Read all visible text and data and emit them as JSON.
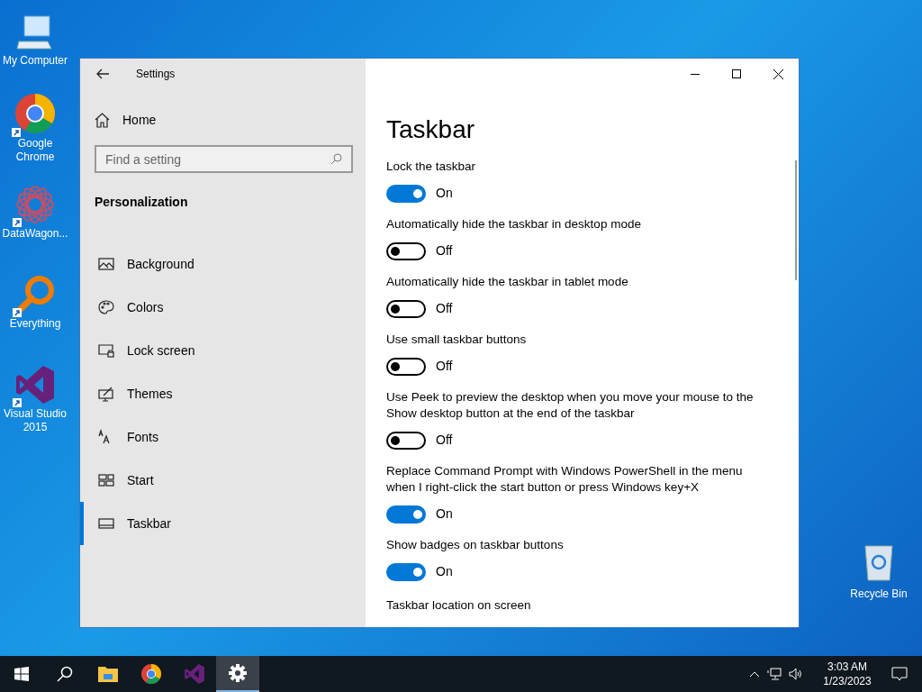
{
  "desktop_icons": [
    {
      "label": "My Computer",
      "kind": "computer",
      "shortcut": false
    },
    {
      "label": "Google Chrome",
      "kind": "chrome",
      "shortcut": true
    },
    {
      "label": "DataWagon...",
      "kind": "flower",
      "shortcut": true
    },
    {
      "label": "Everything",
      "kind": "magnifier",
      "shortcut": true
    },
    {
      "label": "Visual Studio 2015",
      "kind": "vs",
      "shortcut": true
    }
  ],
  "recycle_bin": {
    "label": "Recycle Bin"
  },
  "window": {
    "title": "Settings",
    "home": "Home",
    "search": {
      "placeholder": "Find a setting"
    },
    "section": "Personalization",
    "nav": [
      {
        "label": "Background",
        "kind": "image",
        "selected": false
      },
      {
        "label": "Colors",
        "kind": "palette",
        "selected": false
      },
      {
        "label": "Lock screen",
        "kind": "lock",
        "selected": false
      },
      {
        "label": "Themes",
        "kind": "themes",
        "selected": false
      },
      {
        "label": "Fonts",
        "kind": "fonts",
        "selected": false
      },
      {
        "label": "Start",
        "kind": "start",
        "selected": false
      },
      {
        "label": "Taskbar",
        "kind": "taskbar",
        "selected": true
      }
    ],
    "page_title": "Taskbar",
    "settings": [
      {
        "label": "Lock the taskbar",
        "on": true,
        "state_text": "On"
      },
      {
        "label": "Automatically hide the taskbar in desktop mode",
        "on": false,
        "state_text": "Off"
      },
      {
        "label": "Automatically hide the taskbar in tablet mode",
        "on": false,
        "state_text": "Off"
      },
      {
        "label": "Use small taskbar buttons",
        "on": false,
        "state_text": "Off"
      },
      {
        "label": "Use Peek to preview the desktop when you move your mouse to the Show desktop button at the end of the taskbar",
        "on": false,
        "state_text": "Off"
      },
      {
        "label": "Replace Command Prompt with Windows PowerShell in the menu when I right-click the start button or press Windows key+X",
        "on": true,
        "state_text": "On"
      },
      {
        "label": "Show badges on taskbar buttons",
        "on": true,
        "state_text": "On"
      }
    ],
    "last_label": "Taskbar location on screen"
  },
  "taskbar": {
    "items": [
      {
        "kind": "start",
        "selected": false
      },
      {
        "kind": "search",
        "selected": false
      },
      {
        "kind": "folder",
        "selected": false
      },
      {
        "kind": "chrome",
        "selected": false
      },
      {
        "kind": "vs",
        "selected": false
      },
      {
        "kind": "gear",
        "selected": true
      }
    ],
    "time": "3:03 AM",
    "date": "1/23/2023"
  }
}
